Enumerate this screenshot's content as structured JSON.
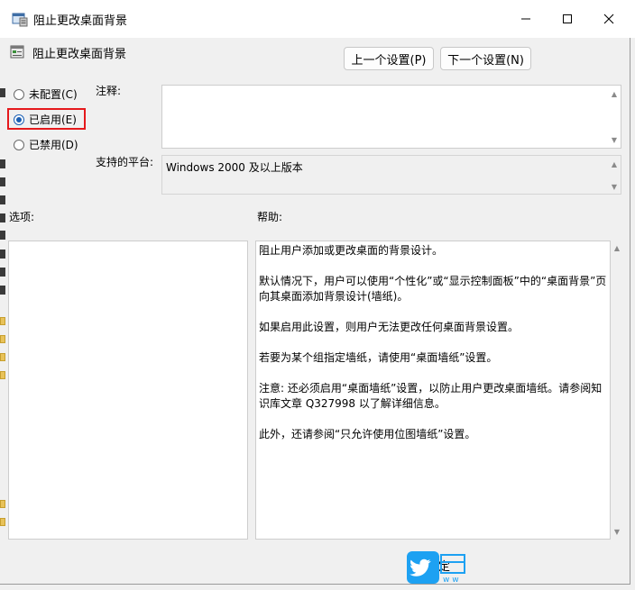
{
  "window": {
    "title": "阻止更改桌面背景"
  },
  "header": {
    "policy_name": "阻止更改桌面背景",
    "prev_button": "上一个设置(P)",
    "next_button": "下一个设置(N)"
  },
  "state": {
    "options": [
      {
        "label": "未配置(C)",
        "selected": false
      },
      {
        "label": "已启用(E)",
        "selected": true
      },
      {
        "label": "已禁用(D)",
        "selected": false
      }
    ]
  },
  "fields": {
    "comment_label": "注释:",
    "comment_value": "",
    "platform_label": "支持的平台:",
    "platform_value": "Windows 2000 及以上版本"
  },
  "panels": {
    "options_label": "选项:",
    "help_label": "帮助:"
  },
  "help": {
    "paragraphs": [
      "阻止用户添加或更改桌面的背景设计。",
      "默认情况下，用户可以使用“个性化”或“显示控制面板”中的“桌面背景”页向其桌面添加背景设计(墙纸)。",
      "如果启用此设置，则用户无法更改任何桌面背景设置。",
      "若要为某个组指定墙纸，请使用“桌面墙纸”设置。",
      "注意: 还必须启用“桌面墙纸”设置，以防止用户更改桌面墙纸。请参阅知识库文章 Q327998 以了解详细信息。",
      "此外，还请参阅“只允许使用位图墙纸”设置。"
    ]
  },
  "footer": {
    "ok_partial": "定"
  },
  "colors": {
    "highlight": "#e5191c",
    "radio_accent": "#1a5fb4",
    "watermark": "#1da1f2"
  }
}
